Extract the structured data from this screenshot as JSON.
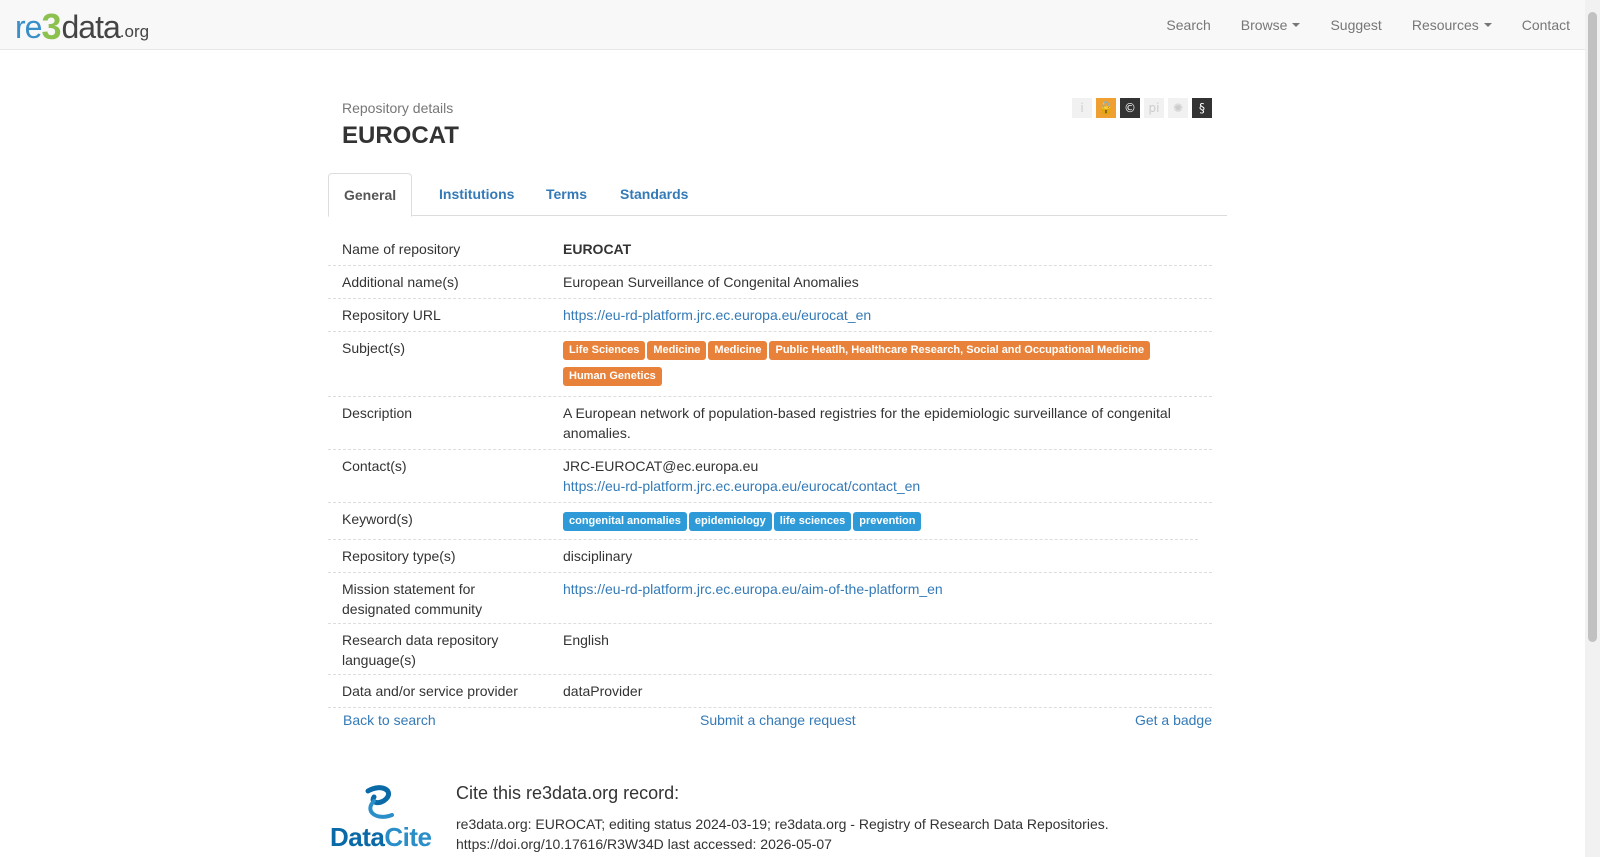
{
  "brand": {
    "re": "re",
    "three": "3",
    "data": "data",
    "org": ".org"
  },
  "nav": {
    "items": [
      {
        "label": "Search",
        "dropdown": false
      },
      {
        "label": "Browse",
        "dropdown": true
      },
      {
        "label": "Suggest",
        "dropdown": false
      },
      {
        "label": "Resources",
        "dropdown": true
      },
      {
        "label": "Contact",
        "dropdown": false
      }
    ]
  },
  "header": {
    "subtitle": "Repository details",
    "title": "EUROCAT"
  },
  "header_icons": [
    {
      "name": "info-icon",
      "glyph": "i",
      "style": "faded"
    },
    {
      "name": "open-access-lock-icon",
      "glyph": "🔓",
      "style": "orange"
    },
    {
      "name": "copyright-icon",
      "glyph": "©",
      "style": "dark"
    },
    {
      "name": "pid-icon",
      "glyph": "pi",
      "style": "faded"
    },
    {
      "name": "certificate-icon",
      "glyph": "✺",
      "style": "faded"
    },
    {
      "name": "policy-icon",
      "glyph": "§",
      "style": "dark"
    }
  ],
  "tabs": [
    {
      "label": "General",
      "active": true
    },
    {
      "label": "Institutions",
      "active": false
    },
    {
      "label": "Terms",
      "active": false
    },
    {
      "label": "Standards",
      "active": false
    }
  ],
  "details": {
    "name_label": "Name of repository",
    "name_value": "EUROCAT",
    "additional_label": "Additional name(s)",
    "additional_value": "European Surveillance of Congenital Anomalies",
    "url_label": "Repository URL",
    "url_value": "https://eu-rd-platform.jrc.ec.europa.eu/eurocat_en",
    "subjects_label": "Subject(s)",
    "subjects": [
      "Life Sciences",
      "Medicine",
      "Medicine",
      "Public Heatlh, Healthcare Research, Social and Occupational Medicine",
      "Human Genetics"
    ],
    "description_label": "Description",
    "description_value": "A European network of population-based registries for the epidemiologic surveillance of congenital anomalies.",
    "contacts_label": "Contact(s)",
    "contact_email": "JRC-EUROCAT@ec.europa.eu",
    "contact_url": "https://eu-rd-platform.jrc.ec.europa.eu/eurocat/contact_en",
    "keywords_label": "Keyword(s)",
    "keywords": [
      "congenital anomalies",
      "epidemiology",
      "life sciences",
      "prevention"
    ],
    "type_label": "Repository type(s)",
    "type_value": "disciplinary",
    "mission_label": "Mission statement for designated community",
    "mission_value": "https://eu-rd-platform.jrc.ec.europa.eu/aim-of-the-platform_en",
    "language_label": "Research data repository language(s)",
    "language_value": "English",
    "provider_label": "Data and/or service provider",
    "provider_value": "dataProvider"
  },
  "footer_links": {
    "back": "Back to search",
    "change": "Submit a change request",
    "badge": "Get a badge"
  },
  "cite": {
    "logo_data": "Data",
    "logo_cite": "Cite",
    "title": "Cite this re3data.org record:",
    "text": "re3data.org: EUROCAT; editing status 2024-03-19; re3data.org - Registry of Research Data Repositories. https://doi.org/10.17616/R3W34D last accessed: 2026-05-07"
  },
  "colors": {
    "subject_chip": "#e8823b",
    "keyword_chip": "#2e9bd8",
    "link": "#337ab7"
  }
}
